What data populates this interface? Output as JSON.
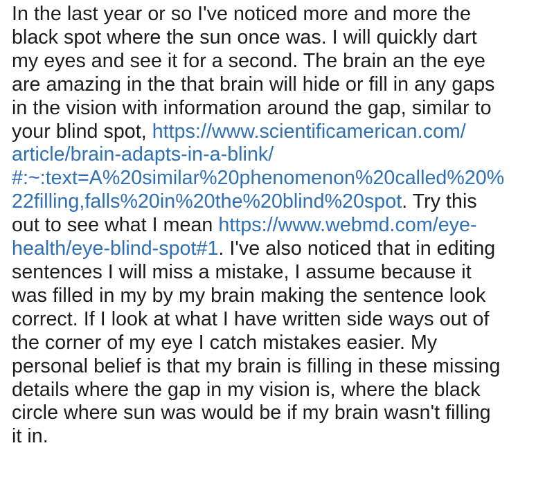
{
  "post": {
    "lines": [
      [
        {
          "text": "In the last year or so I've noticed more and more the"
        }
      ],
      [
        {
          "text": "black spot where the sun once was. I will quickly dart"
        }
      ],
      [
        {
          "text": "my eyes and see it for a second. The brain an the eye"
        }
      ],
      [
        {
          "text": "are amazing in the that brain will hide or fill in any gaps"
        }
      ],
      [
        {
          "text": "in the vision with information around the gap, similar to"
        }
      ],
      [
        {
          "text": "your blind spot, "
        },
        {
          "text": "https://www.scientificamerican.com/",
          "link": true
        }
      ],
      [
        {
          "text": "article/brain-adapts-in-a-blink/",
          "link": true
        }
      ],
      [
        {
          "text": "#:~:text=A%20similar%20phenomenon%20called%20%",
          "link": true
        }
      ],
      [
        {
          "text": "22filling,falls%20in%20the%20blind%20spot",
          "link": true
        },
        {
          "text": ". Try this"
        }
      ],
      [
        {
          "text": "out to see what I mean "
        },
        {
          "text": "https://www.webmd.com/eye-",
          "link": true
        }
      ],
      [
        {
          "text": "health/eye-blind-spot#1",
          "link": true
        },
        {
          "text": ". I've also noticed that in editing"
        }
      ],
      [
        {
          "text": "sentences I will miss a mistake, I assume because it"
        }
      ],
      [
        {
          "text": "was filled in my by my brain  making the sentence look"
        }
      ],
      [
        {
          "text": "correct. If I look at what I have written side ways out of"
        }
      ],
      [
        {
          "text": "the corner of my eye I catch mistakes easier. My"
        }
      ],
      [
        {
          "text": "personal belief is that my brain is filling in these missing"
        }
      ],
      [
        {
          "text": "details where the gap in my vision is, where the black"
        }
      ],
      [
        {
          "text": "circle where sun was would be if my brain wasn't filling"
        }
      ],
      [
        {
          "text": "it in."
        }
      ]
    ]
  },
  "colors": {
    "text": "#1c1c1e",
    "link": "#2f6fb6",
    "background": "#ffffff"
  }
}
